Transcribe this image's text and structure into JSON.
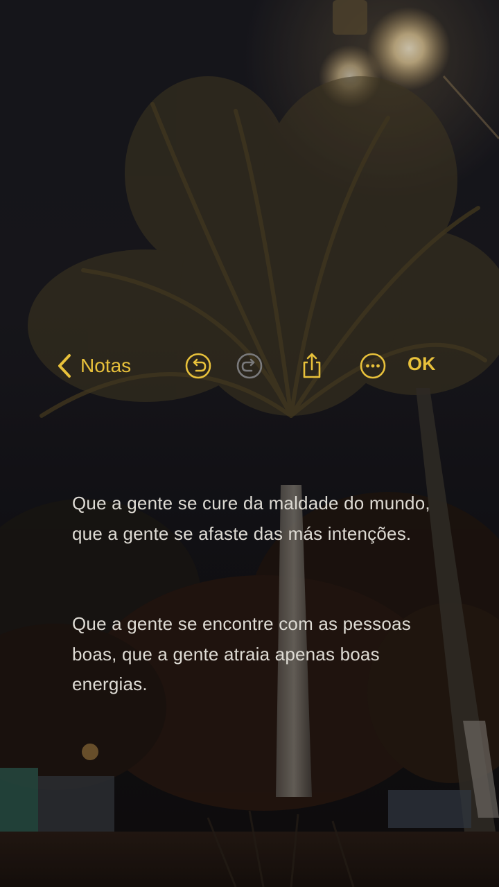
{
  "toolbar": {
    "back_label": "Notas",
    "ok_label": "OK",
    "accent_color": "#e8c13b",
    "disabled_color": "#7a7a7c",
    "icons": {
      "back": "chevron-left-icon",
      "undo": "undo-icon",
      "redo": "redo-icon",
      "share": "share-icon",
      "more": "more-options-icon"
    },
    "redo_enabled": false
  },
  "note": {
    "paragraphs": [
      "Que a gente se cure da maldade do mundo, que a gente se afaste das más intenções.",
      "Que a gente se encontre com as pessoas boas, que a gente atraia apenas boas energias."
    ],
    "text_color": "#dedbd4"
  },
  "background": {
    "scene": "night sky with palm tree and street light",
    "sky_color": "#1b1b22"
  }
}
